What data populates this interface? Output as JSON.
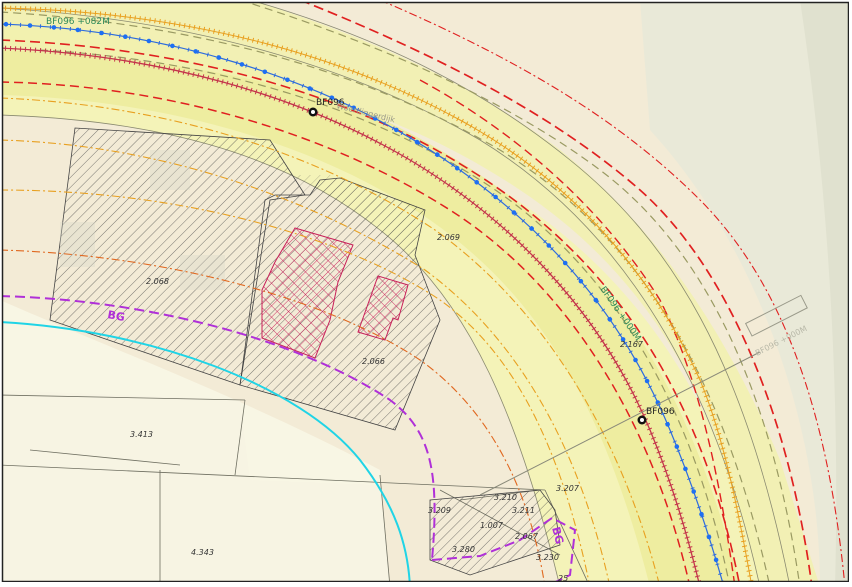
{
  "map": {
    "km_labels": {
      "top": "BF096 +082M",
      "middle": "BF096 +000M",
      "callout": "BF096 +000M"
    },
    "markers": [
      {
        "label": "BF096"
      },
      {
        "label": "BF096"
      }
    ],
    "street_name": "Woerdingerdijk",
    "boundary_labels": {
      "left": "BG",
      "lower": "BG"
    },
    "parcel_labels": [
      "2.069",
      "2.068",
      "2.066",
      "2.167",
      "3.413",
      "4.343",
      "3.209",
      "3.210",
      "3.211",
      "1.007",
      "2.067",
      "3.280",
      "3.207",
      "3.230",
      "25"
    ],
    "colors": {
      "background_land": "#f3ebd6",
      "dike_fill": "#f4f3a9",
      "road_fill": "#eeec9a",
      "grey_right": "#e8e8d6",
      "dense_axis": "#c4344b",
      "chainage_line": "#2d6bde",
      "chainage_point": "#1e6ff2",
      "red_dashed": "#e02020",
      "orange_dashdot": "#e8a020",
      "olive_dashed": "#9a9a62",
      "boundary_bg": "#b030d8",
      "water_cyan": "#20d4e6",
      "building_pink": "#d84a78",
      "text_green": "#2e8a5a"
    }
  }
}
